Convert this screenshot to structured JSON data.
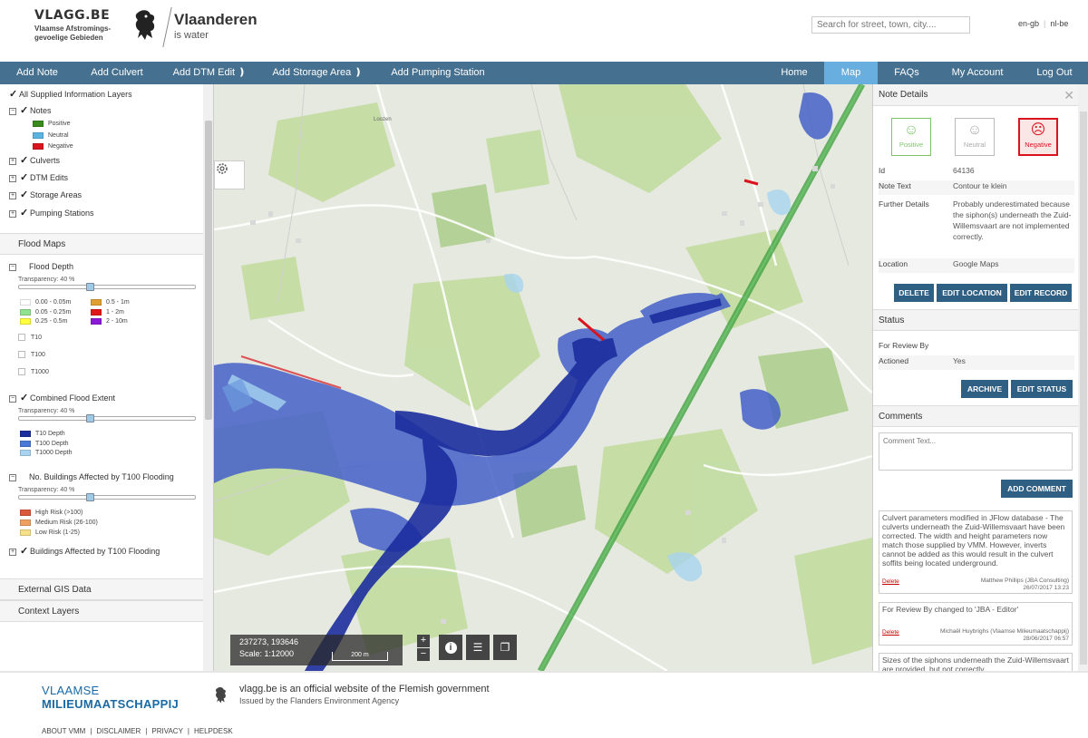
{
  "header": {
    "brand_title": "VLAGG.BE",
    "brand_sub1": "Vlaamse Afstromings-",
    "brand_sub2": "gevoelige Gebieden",
    "logo_title": "Vlaanderen",
    "logo_sub": "is water",
    "search_placeholder": "Search for street, town, city....",
    "lang_en": "en-gb",
    "lang_nl": "nl-be"
  },
  "nav": {
    "add_note": "Add Note",
    "add_culvert": "Add Culvert",
    "add_dtm": "Add DTM Edit ❫",
    "add_storage": "Add Storage Area ❫",
    "add_pumping": "Add Pumping Station",
    "home": "Home",
    "map": "Map",
    "faqs": "FAQs",
    "account": "My Account",
    "logout": "Log Out"
  },
  "sidebar": {
    "all_layers": "All Supplied Information Layers",
    "notes": "Notes",
    "notes_legend": [
      {
        "label": "Positive",
        "color": "#3a8a1e"
      },
      {
        "label": "Neutral",
        "color": "#5bb3e0"
      },
      {
        "label": "Negative",
        "color": "#d9141e"
      }
    ],
    "culverts": "Culverts",
    "dtm_edits": "DTM Edits",
    "storage_areas": "Storage Areas",
    "pumping_stations": "Pumping Stations",
    "flood_maps": "Flood Maps",
    "flood_depth": "Flood Depth",
    "transparency": "Transparency: 40 %",
    "depth_legend": [
      {
        "label": "0.00 - 0.05m",
        "color": "#ffffff"
      },
      {
        "label": "0.05 - 0.25m",
        "color": "#8fe38f"
      },
      {
        "label": "0.25 - 0.5m",
        "color": "#ffff40"
      },
      {
        "label": "0.5 - 1m",
        "color": "#e0a030"
      },
      {
        "label": "1 - 2m",
        "color": "#e01818"
      },
      {
        "label": "2 - 10m",
        "color": "#8a1ad6"
      }
    ],
    "t10": "T10",
    "t100": "T100",
    "t1000": "T1000",
    "combined": "Combined Flood Extent",
    "combined_legend": [
      {
        "label": "T10 Depth",
        "color": "#1c2e9e"
      },
      {
        "label": "T100 Depth",
        "color": "#4a7ad8"
      },
      {
        "label": "T1000 Depth",
        "color": "#a8d4f0"
      }
    ],
    "buildings_no": "No. Buildings Affected by T100 Flooding",
    "risk_legend": [
      {
        "label": "High Risk (>100)",
        "color": "#d85a3a"
      },
      {
        "label": "Medium Risk (26-100)",
        "color": "#f0a060"
      },
      {
        "label": "Low Risk (1-25)",
        "color": "#f6e08a"
      }
    ],
    "buildings_affected": "Buildings Affected by T100 Flooding",
    "external_gis": "External GIS Data",
    "context_layers": "Context Layers"
  },
  "map": {
    "coords": "237273, 193646",
    "scale": "Scale: 1:12000",
    "scalebar": "200 m",
    "place_label": "Loozen"
  },
  "panel": {
    "title": "Note Details",
    "positive": "Positive",
    "neutral": "Neutral",
    "negative": "Negative",
    "id_label": "Id",
    "id_value": "64136",
    "note_text_label": "Note Text",
    "note_text_value": "Contour te klein",
    "further_label": "Further Details",
    "further_value": "Probably underestimated because the siphon(s) underneath the Zuid-Willemsvaart are not implemented correctly.",
    "location_label": "Location",
    "location_value": "Google Maps",
    "btn_delete": "DELETE",
    "btn_edit_location": "EDIT LOCATION",
    "btn_edit_record": "EDIT RECORD",
    "status_title": "Status",
    "review_label": "For Review By",
    "review_value": "",
    "actioned_label": "Actioned",
    "actioned_value": "Yes",
    "btn_archive": "ARCHIVE",
    "btn_edit_status": "EDIT STATUS",
    "comments_title": "Comments",
    "comment_placeholder": "Comment Text...",
    "btn_add_comment": "ADD COMMENT",
    "comments": [
      {
        "text": "Culvert parameters modified in JFlow database - The culverts underneath the Zuid-Willemsvaart have been corrected. The width and height parameters now match those supplied by VMM. However, inverts cannot be added as this would result in the culvert soffits being located underground.",
        "author": "Matthew Phillips (JBA Consulting)",
        "date": "26/07/2017 13:23",
        "delete": "Delete"
      },
      {
        "text": "For Review By changed to 'JBA - Editor'",
        "author": "Michaël Huybrighs (Vlaamse Milieumaatschappij)",
        "date": "28/06/2017 06:57",
        "delete": "Delete"
      },
      {
        "text": "Sizes of the siphons underneath the Zuid-Willemsvaart are provided, but not correctly",
        "author": "",
        "date": "",
        "delete": ""
      }
    ]
  },
  "footer": {
    "vmm1": "VLAAMSE",
    "vmm2": "MILIEUMAATSCHAPPIJ",
    "msg": "vlagg.be is an official website of the Flemish government",
    "msg2": "Issued by the Flanders Environment Agency",
    "about": "ABOUT VMM",
    "disclaimer": "DISCLAIMER",
    "privacy": "PRIVACY",
    "helpdesk": "HELPDESK"
  }
}
